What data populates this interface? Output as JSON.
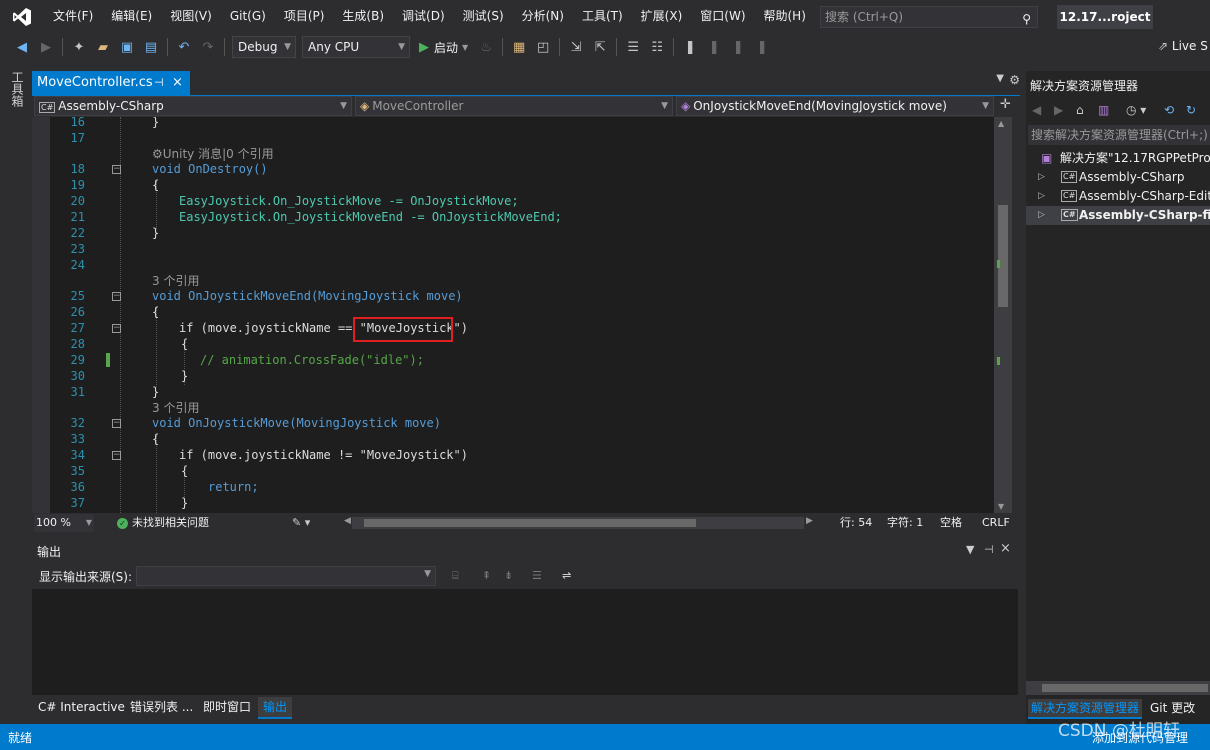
{
  "menu": {
    "items": [
      "文件(F)",
      "编辑(E)",
      "视图(V)",
      "Git(G)",
      "项目(P)",
      "生成(B)",
      "调试(D)",
      "测试(S)",
      "分析(N)",
      "工具(T)",
      "扩展(X)",
      "窗口(W)",
      "帮助(H)"
    ],
    "search_placeholder": "搜索 (Ctrl+Q)",
    "project_title": "12.17...roject"
  },
  "toolbar": {
    "config": "Debug",
    "platform": "Any CPU",
    "start_label": "启动",
    "live_share": "Live S"
  },
  "left_toolbox": "工具箱",
  "tab": {
    "file": "MoveController.cs",
    "pin": "⊣",
    "close": "×"
  },
  "nav": {
    "project": "Assembly-CSharp",
    "class": "MoveController",
    "member": "OnJoystickMoveEnd(MovingJoystick move)"
  },
  "code_lines": [
    {
      "n": "16",
      "text": "}"
    },
    {
      "n": "17",
      "text": ""
    },
    {
      "hint": "⚙Unity 消息|0 个引用"
    },
    {
      "n": "18",
      "text": "void OnDestroy()"
    },
    {
      "n": "19",
      "text": "{"
    },
    {
      "n": "20",
      "text": "EasyJoystick.On_JoystickMove -= OnJoystickMove;"
    },
    {
      "n": "21",
      "text": "EasyJoystick.On_JoystickMoveEnd -= OnJoystickMoveEnd;"
    },
    {
      "n": "22",
      "text": "}"
    },
    {
      "n": "23",
      "text": ""
    },
    {
      "n": "24",
      "text": ""
    },
    {
      "hint": "3 个引用"
    },
    {
      "n": "25",
      "text": "void OnJoystickMoveEnd(MovingJoystick move)"
    },
    {
      "n": "26",
      "text": "{"
    },
    {
      "n": "27",
      "text": "if (move.joystickName == \"MoveJoystick\")"
    },
    {
      "n": "28",
      "text": "{"
    },
    {
      "n": "29",
      "text": "// animation.CrossFade(\"idle\");"
    },
    {
      "n": "30",
      "text": "}"
    },
    {
      "n": "31",
      "text": "}"
    },
    {
      "hint": "3 个引用"
    },
    {
      "n": "32",
      "text": "void OnJoystickMove(MovingJoystick move)"
    },
    {
      "n": "33",
      "text": "{"
    },
    {
      "n": "34",
      "text": "if (move.joystickName != \"MoveJoystick\")"
    },
    {
      "n": "35",
      "text": "{"
    },
    {
      "n": "36",
      "text": "return;"
    },
    {
      "n": "37",
      "text": "}"
    }
  ],
  "editor_status": {
    "zoom": "100 %",
    "issues": "未找到相关问题",
    "line": "行: 54",
    "char": "字符: 1",
    "spaces": "空格",
    "eol": "CRLF"
  },
  "output": {
    "title": "输出",
    "source_label": "显示输出来源(S):",
    "source_value": ""
  },
  "bottom_tabs": [
    "C# Interactive",
    "错误列表 ...",
    "即时窗口",
    "输出"
  ],
  "solution": {
    "title": "解决方案资源管理器",
    "search_placeholder": "搜索解决方案资源管理器(Ctrl+;)",
    "root": "解决方案\"12.17RGPPetProj",
    "items": [
      "Assembly-CSharp",
      "Assembly-CSharp-Edito",
      "Assembly-CSharp-firs"
    ],
    "tab_active": "解决方案资源管理器",
    "tab_other": "Git 更改"
  },
  "statusbar": {
    "ready": "就绪",
    "right": "添加到源代码管理",
    "watermark": "CSDN @杜明轩"
  },
  "colors": {
    "accent": "#007acc",
    "editor_bg": "#1e1e1e",
    "chrome_bg": "#2d2d30",
    "highlight_box": "#e02020",
    "line_number": "#2b91af",
    "keyword": "#569cd6",
    "type": "#4ec9b0",
    "string": "#d69d85",
    "comment": "#57a64a"
  }
}
